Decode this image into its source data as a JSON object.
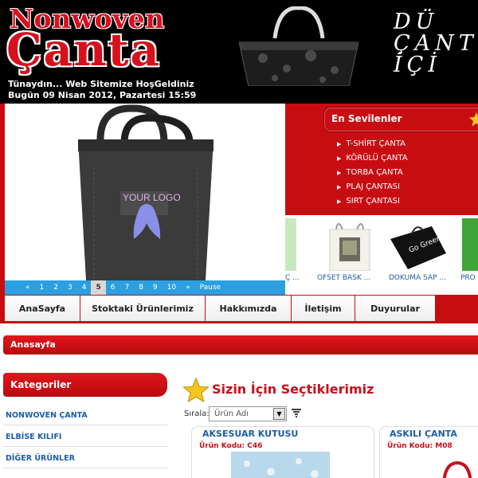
{
  "header": {
    "logo_line1": "Nonwoven",
    "logo_line2": "Çanta",
    "greeting": "Tünaydın... Web Sitemize HoşGeldiniz",
    "datetime": "Bugün 09 Nisan 2012, Pazartesi 15:59",
    "slogan_line1": "DÜ",
    "slogan_line2": "ÇANT",
    "slogan_line3": "İÇİ"
  },
  "slider": {
    "bag_logo_text": "YOUR LOGO",
    "pager": [
      "«",
      "1",
      "2",
      "3",
      "4",
      "5",
      "6",
      "7",
      "8",
      "9",
      "10",
      "»",
      "Pause"
    ],
    "active_page": "5"
  },
  "favorites": {
    "title": "En Sevilenler",
    "items": [
      "T-SHİRT ÇANTA",
      "KÖRÜLÜ ÇANTA",
      "TORBA ÇANTA",
      "PLAJ ÇANTASI",
      "SIRT ÇANTASI"
    ]
  },
  "product_strip": {
    "items": [
      "Ç ...",
      "OFSET BASK ...",
      "DOKUMA SAP ...",
      "PRO"
    ],
    "bag_print_text": "Go Green"
  },
  "menu": {
    "items": [
      "AnaSayfa",
      "Stoktaki Ürünlerimiz",
      "Hakkımızda",
      "İletişim",
      "Duyurular"
    ]
  },
  "breadcrumb": {
    "current": "Anasayfa"
  },
  "sidebar": {
    "title": "Kategoriler",
    "items": [
      "NONWOVEN ÇANTA",
      "ELBİSE KILIFI",
      "DİĞER ÜRÜNLER"
    ]
  },
  "main": {
    "title": "Sizin İçin Seçtiklerimiz",
    "sort_label": "Sırala:",
    "sort_value": "Ürün Adı",
    "products": [
      {
        "name": "AKSESUAR KUTUSU",
        "code": "Ürün Kodu: C46"
      },
      {
        "name": "ASKILI ÇANTA",
        "code": "Ürün Kodu: M08"
      }
    ]
  },
  "colors": {
    "brand_red": "#c80d12",
    "link_blue": "#1b5ea8",
    "pager_blue": "#2aa0e2"
  }
}
